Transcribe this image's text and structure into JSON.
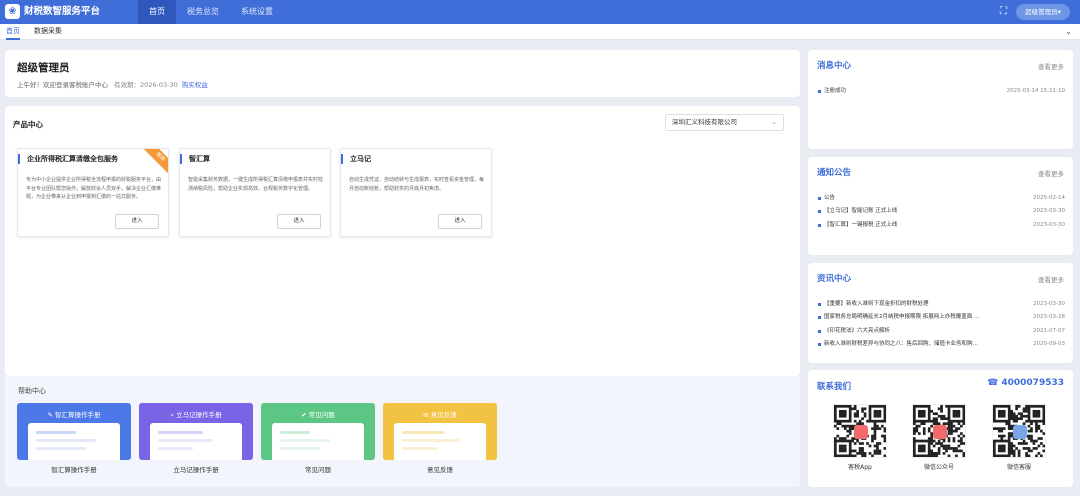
{
  "topbar": {
    "logo_glyph": "❀",
    "brand": "财税数智服务平台",
    "nav": [
      "首页",
      "税务总览",
      "系统设置"
    ],
    "fullscreen_glyph": "⛶",
    "user_button": "超级管理员▾"
  },
  "tabs": {
    "items": [
      "首页",
      "数据采集"
    ],
    "dropdown_glyph": "⌄"
  },
  "welcome": {
    "name": "超级管理员",
    "greeting": "上午好！欢迎登录客税账户中心",
    "expiry_label": "有效期：",
    "expiry_date": "2026-03-30",
    "buy_link": "购买权益"
  },
  "products": {
    "title": "产品中心",
    "company_select": "深圳汇义科技有限公司",
    "select_arrow": "⌄",
    "cards": [
      {
        "title": "企业所得税汇算清缴全包服务",
        "desc": "专为中小企业提供企业所得税全流程申报的财税服务平台，由平台专业团队帮您操作，解放财会人员双手，解决企业汇缴难题，为企业带来从企业到申报到汇缴的一站式服务。",
        "button": "进入",
        "badge": "推荐"
      },
      {
        "title": "智汇算",
        "desc": "智能采集财务数据，一键生成所得税汇算清缴申报表并实时检测纳税风险，帮助企业实现高效、合规税务数字化管理。",
        "button": "进入"
      },
      {
        "title": "立马记",
        "desc": "自动生成凭证、自动结转与生成报表，实时查看资金管理，每月自动账结账，帮助财务的月底月初焦虑。",
        "button": "进入"
      }
    ]
  },
  "help": {
    "title": "帮助中心",
    "cards": [
      {
        "heading": "智汇算操作手册",
        "label": "智汇算操作手册",
        "icon": "wrench-icon",
        "icon_glyph": "✎",
        "color": "#4c78e8"
      },
      {
        "heading": "立马记操作手册",
        "label": "立马记操作手册",
        "icon": "search-icon",
        "icon_glyph": "⌕",
        "color": "#7b63e6"
      },
      {
        "heading": "常见问题",
        "label": "常见问题",
        "icon": "question-icon",
        "icon_glyph": "✔",
        "color": "#5cc784"
      },
      {
        "heading": "意见反馈",
        "label": "意见反馈",
        "icon": "feedback-icon",
        "icon_glyph": "✉",
        "color": "#f2c242"
      }
    ]
  },
  "messages": {
    "title": "消息中心",
    "more": "查看更多",
    "items": [
      {
        "text": "注册成功",
        "date": "2025-03-14 15:11:10"
      }
    ]
  },
  "notices": {
    "title": "通知公告",
    "more": "查看更多",
    "items": [
      {
        "text": "公告",
        "date": "2025-02-14"
      },
      {
        "text": "【立马记】智能记账 正式上线",
        "date": "2023-03-30"
      },
      {
        "text": "【智汇算】一键报税 正式上线",
        "date": "2023-03-30"
      }
    ]
  },
  "news": {
    "title": "资讯中心",
    "more": "查看更多",
    "items": [
      {
        "text": "【重要】新收入准则下现金折扣的财税处理",
        "date": "2023-03-30"
      },
      {
        "text": "国家税务总局明确延长2月纳税申报期限 拓展网上办税覆盖面 …",
        "date": "2023-03-28"
      },
      {
        "text": "《印花税法》六大亮点解析",
        "date": "2021-07-07"
      },
      {
        "text": "新收入准则财税差异与协同之八：售后回购、储值卡业务和购…",
        "date": "2020-09-03"
      }
    ]
  },
  "contact": {
    "title": "联系我们",
    "phone_glyph": "☎",
    "phone": "4000079533",
    "qrcodes": [
      {
        "label": "客税App",
        "center_color": "#f26b6b"
      },
      {
        "label": "微信公众号",
        "center_color": "#f26b6b"
      },
      {
        "label": "微信客服",
        "center_color": "#7aa6e8"
      }
    ]
  },
  "colors": {
    "primary": "#3f6ed8",
    "nav_active": "#2e58be",
    "badge": "#f59a3b"
  }
}
